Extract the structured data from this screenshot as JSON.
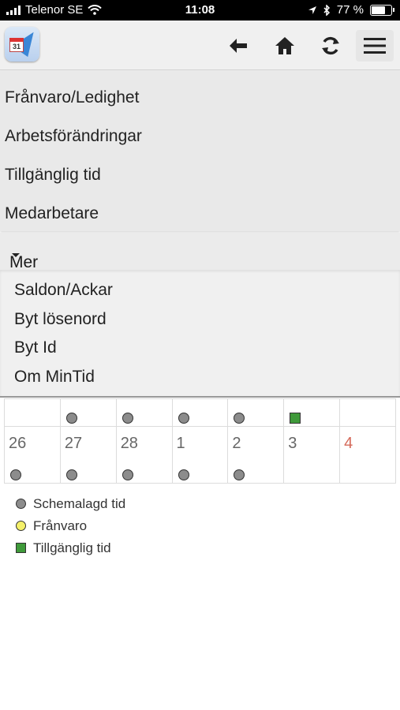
{
  "status_bar": {
    "carrier": "Telenor SE",
    "time": "11:08",
    "battery": "77 %",
    "battery_level": 0.77
  },
  "header": {
    "logo_text": "31",
    "buttons": [
      "back-arrow-icon",
      "home-icon",
      "refresh-icon",
      "hamburger-menu-icon"
    ]
  },
  "main_menu": {
    "items": [
      {
        "label": "Frånvaro/Ledighet"
      },
      {
        "label": "Arbetsförändringar"
      },
      {
        "label": "Tillgänglig tid"
      },
      {
        "label": "Medarbetare"
      }
    ],
    "more_label": "Mer"
  },
  "more_menu": {
    "items": [
      {
        "label": "Saldon/Ackar"
      },
      {
        "label": "Byt lösenord"
      },
      {
        "label": "Byt Id"
      },
      {
        "label": "Om MinTid"
      }
    ]
  },
  "calendar": {
    "row1_markers": [
      "none",
      "dot",
      "dot",
      "dot",
      "dot",
      "square",
      "none"
    ],
    "days": [
      {
        "label": "26",
        "marker": "dot"
      },
      {
        "label": "27",
        "marker": "dot"
      },
      {
        "label": "28",
        "marker": "dot"
      },
      {
        "label": "1",
        "marker": "dot"
      },
      {
        "label": "2",
        "marker": "dot"
      },
      {
        "label": "3",
        "marker": "none"
      },
      {
        "label": "4",
        "marker": "none",
        "sunday": true
      }
    ]
  },
  "legend": {
    "scheduled": "Schemalagd tid",
    "absence": "Frånvaro",
    "available": "Tillgänglig tid",
    "colors": {
      "scheduled": "#8c8c8c",
      "absence": "#f4f06a",
      "available": "#3f9a3a",
      "sunday": "#d56a5a"
    }
  }
}
